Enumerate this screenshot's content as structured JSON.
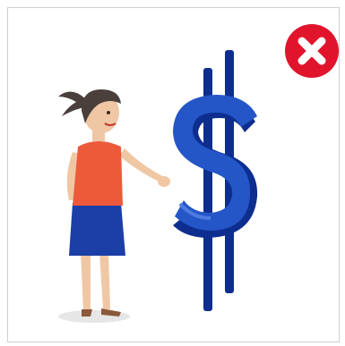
{
  "dialog": {
    "close_icon": "close-icon",
    "close_color": "#e0142b"
  },
  "illustration": {
    "person_icon": "woman-icon",
    "symbol_icon": "dollar-sign-icon",
    "symbol_color": "#1c46b8",
    "shirt_color": "#ec5a3a",
    "skirt_color": "#1b3fa6"
  }
}
